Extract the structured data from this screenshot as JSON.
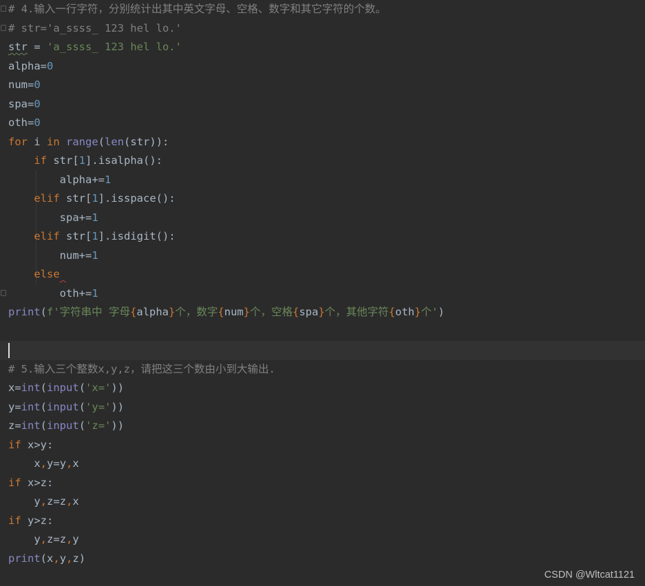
{
  "code": {
    "comment_q4": "# 4.输入一行字符，分别统计出其中英文字母、空格、数字和其它字符的个数。",
    "comment_str": "# str='a_ssss_ 123 hel lo.'",
    "var_str": "str",
    "assign_eq": " = ",
    "str_value": "'a_ssss_ 123 hel lo.'",
    "alpha": "alpha",
    "num": "num",
    "spa": "spa",
    "oth": "oth",
    "eq": "=",
    "zero": "0",
    "one": "1",
    "kw_for": "for",
    "kw_in": "in",
    "kw_if": "if",
    "kw_elif": "elif",
    "kw_else": "else",
    "var_i": " i ",
    "fn_range": "range",
    "fn_len": "len",
    "lparen": "(",
    "rparen": ")",
    "close_colon": ")):",
    "index_open": "str[",
    "index_close": "]",
    "isalpha": ".isalpha():",
    "isspace": ".isspace():",
    "isdigit": ".isdigit():",
    "alpha_inc": "alpha+=",
    "spa_inc": "spa+=",
    "num_inc": "num+=",
    "oth_inc": "oth+=",
    "fn_print": "print",
    "fstring_prefix": "f'字符串中 字母",
    "lbrace": "{",
    "rbrace": "}",
    "fstring_mid1": "个，数字",
    "fstring_mid2": "个，空格",
    "fstring_mid3": "个，其他字符",
    "fstring_end": "个'",
    "comment_q5": "# 5.输入三个整数x,y,z，请把这三个数由小到大输出.",
    "x_eq": "x=",
    "y_eq": "y=",
    "z_eq": "z=",
    "fn_int": "int",
    "fn_input": "input",
    "str_x": "'x='",
    "str_y": "'y='",
    "str_z": "'z='",
    "double_close": "))",
    "cond_xy": " x>y:",
    "cond_xz": " x>z:",
    "cond_yz": " y>z:",
    "x": "x",
    "y": "y",
    "z": "z",
    "comma": ",",
    "swap_xy_mid": "=y",
    "swap_xz_mid": "=z",
    "swap_yz_mid": "=z",
    "print_args_x": "(x",
    "print_args_y": "y",
    "print_args_z": "z)"
  },
  "watermark": "CSDN @Wltcat1121"
}
